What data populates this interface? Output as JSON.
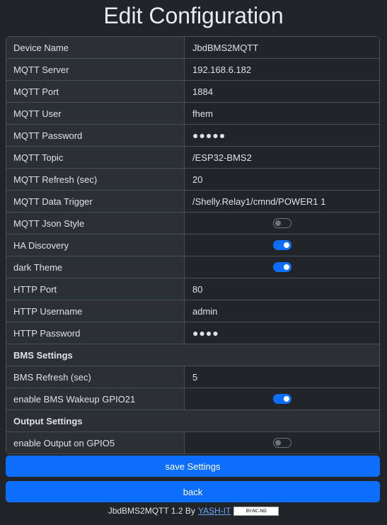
{
  "page": {
    "title": "Edit Configuration"
  },
  "settings": [
    {
      "label": "Device Name",
      "value": "JbdBMS2MQTT"
    },
    {
      "label": "MQTT Server",
      "value": "192.168.6.182"
    },
    {
      "label": "MQTT Port",
      "value": "1884"
    },
    {
      "label": "MQTT User",
      "value": "fhem"
    },
    {
      "label": "MQTT Password",
      "value": "●●●●●"
    },
    {
      "label": "MQTT Topic",
      "value": "/ESP32-BMS2"
    },
    {
      "label": "MQTT Refresh (sec)",
      "value": "20"
    },
    {
      "label": "MQTT Data Trigger",
      "value": "/Shelly.Relay1/cmnd/POWER1 1"
    },
    {
      "label": "MQTT Json Style",
      "toggle": false
    },
    {
      "label": "HA Discovery",
      "toggle": true
    },
    {
      "label": "dark Theme",
      "toggle": true
    },
    {
      "label": "HTTP Port",
      "value": "80"
    },
    {
      "label": "HTTP Username",
      "value": "admin"
    },
    {
      "label": "HTTP Password",
      "value": "●●●●"
    }
  ],
  "bms": {
    "heading": "BMS Settings",
    "refresh_label": "BMS Refresh (sec)",
    "refresh_value": "5",
    "wakeup_label": "enable BMS Wakeup GPIO21",
    "wakeup_on": true
  },
  "output": {
    "heading": "Output Settings",
    "gpio_label": "enable Output on GPIO5",
    "gpio_on": false
  },
  "buttons": {
    "save": "save Settings",
    "back": "back"
  },
  "footer": {
    "text": "JbdBMS2MQTT 1.2 By",
    "link": "YASH-IT",
    "license": "BY-NC-ND"
  },
  "colors": {
    "accent": "#0d6efd",
    "background": "#212529"
  }
}
